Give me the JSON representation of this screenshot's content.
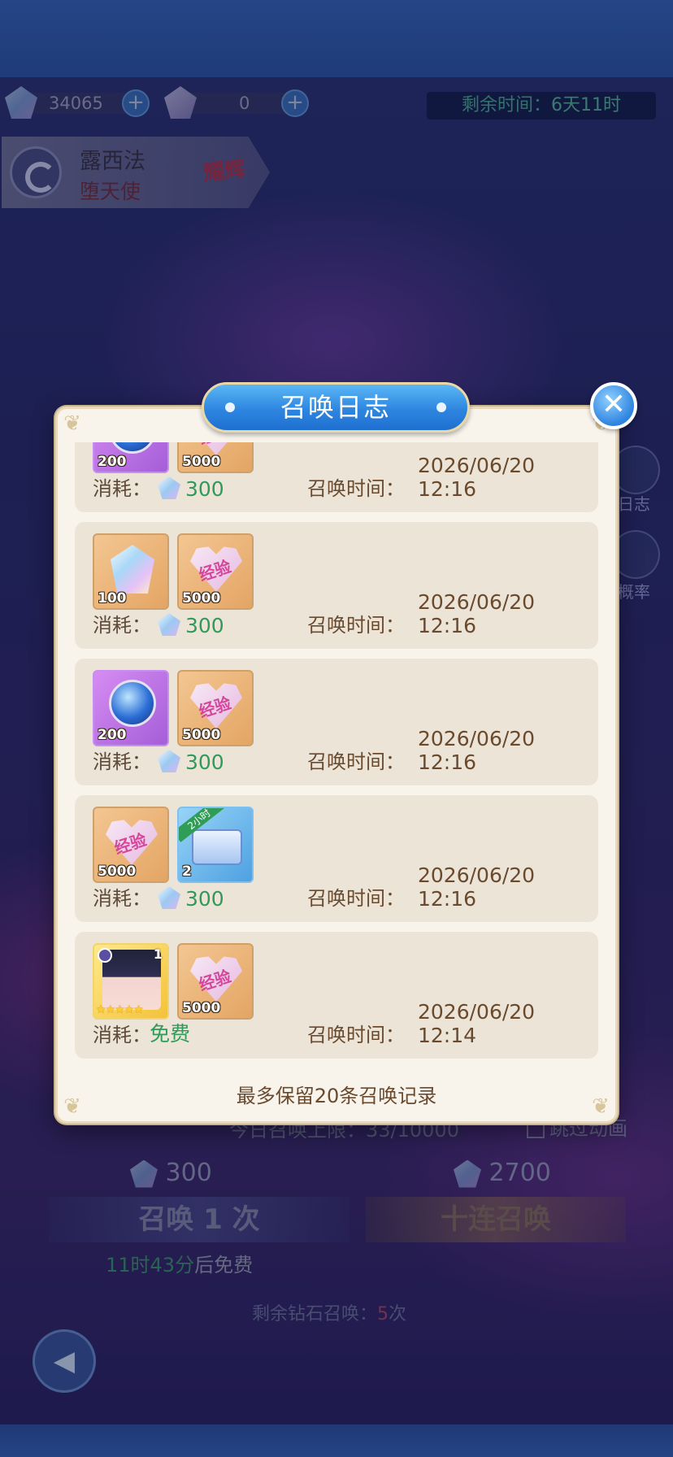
{
  "currency": {
    "diamonds": "34065",
    "tickets": "0",
    "plus_symbol": "+",
    "timer_label": "剩余时间：",
    "timer_value": "6天11时"
  },
  "hero": {
    "name": "露西法",
    "title": "堕天使",
    "badge": "耀辉"
  },
  "side": {
    "log_label": "日志",
    "rate_label": "概率"
  },
  "background": {
    "summon_limit_prefix": "今日召唤上限：",
    "summon_limit_value": "33/10000",
    "skip_animation": "跳过动画",
    "single_cost": "300",
    "ten_cost": "2700",
    "single_button": "召唤 1 次",
    "ten_button": "十连召唤",
    "free_time": "11时43分",
    "free_suffix": "后免费",
    "remain_prefix": "剩余钻石召唤：",
    "remain_count": "5",
    "remain_suffix": "次",
    "back_icon": "◀"
  },
  "modal": {
    "title": "召唤日志",
    "close_symbol": "✕",
    "cost_label": "消耗：",
    "time_label": "召唤时间：",
    "footer": "最多保留20条召唤记录",
    "corner_glyph": "❦",
    "exp_text": "经验",
    "ribbon_text": "2小时",
    "stars_text": "★★★★★",
    "entries": [
      {
        "items": [
          {
            "type": "orb",
            "qty": "200"
          },
          {
            "type": "exp",
            "qty": "5000"
          }
        ],
        "cost": "300",
        "time": "2026/06/20 12:16"
      },
      {
        "items": [
          {
            "type": "crystal",
            "qty": "100"
          },
          {
            "type": "exp",
            "qty": "5000"
          }
        ],
        "cost": "300",
        "time": "2026/06/20 12:16"
      },
      {
        "items": [
          {
            "type": "orb",
            "qty": "200"
          },
          {
            "type": "exp",
            "qty": "5000"
          }
        ],
        "cost": "300",
        "time": "2026/06/20 12:16"
      },
      {
        "items": [
          {
            "type": "exp",
            "qty": "5000"
          },
          {
            "type": "chest",
            "qty": "2"
          }
        ],
        "cost": "300",
        "time": "2026/06/20 12:16"
      },
      {
        "items": [
          {
            "type": "character",
            "qty": "1"
          },
          {
            "type": "exp",
            "qty": "5000"
          }
        ],
        "cost": "免费",
        "time": "2026/06/20 12:14"
      }
    ]
  },
  "colors": {
    "modal_bg": "#f8f4ec",
    "entry_bg": "#ece4d6",
    "title_blue": "#2e86e0",
    "cost_green": "#2f9a5a",
    "time_brown": "#6a4a2e"
  }
}
